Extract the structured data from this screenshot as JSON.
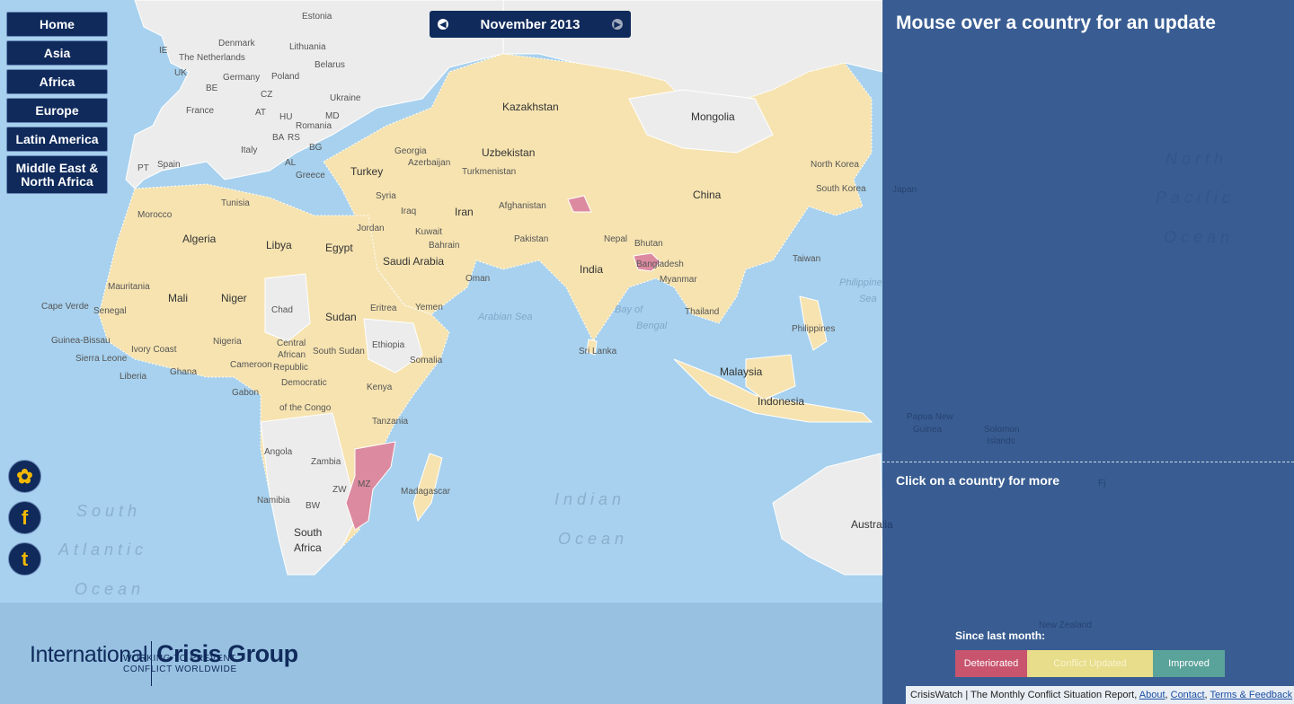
{
  "nav": [
    "Home",
    "Asia",
    "Africa",
    "Europe",
    "Latin America",
    "Middle East & North Africa"
  ],
  "month": {
    "label": "November 2013",
    "prev_icon": "chevron-left-icon",
    "next_icon": "chevron-right-icon"
  },
  "panel": {
    "title": "Mouse over a country for an update",
    "more": "Click on a country for more"
  },
  "legend": {
    "title": "Since last month:",
    "items": [
      {
        "label": "Deteriorated",
        "color": "#c8546e"
      },
      {
        "label": "Conflict Updated",
        "color": "#e8dd8a"
      },
      {
        "label": "Improved",
        "color": "#5aa39a"
      }
    ]
  },
  "logo": {
    "word1": "International",
    "word2": "Crisis Group",
    "tagline1": "WORKING TO PREVENT",
    "tagline2": "CONFLICT WORLDWIDE"
  },
  "social": [
    "twitter-icon",
    "facebook-icon",
    "tumblr-icon"
  ],
  "credit": {
    "text": "CrisisWatch | The Monthly Conflict Situation Report, ",
    "links": [
      "About",
      "Contact",
      "Terms & Feedback"
    ]
  },
  "map": {
    "colors": {
      "ocean": "#a7d1ee",
      "land": "#ececec",
      "updated": "#f6e3b0",
      "deteriorated": "#dc8aa0"
    },
    "oceans": [
      "South",
      "Atlantic",
      "Ocean",
      "Indian",
      "Ocean",
      "North",
      "Pacific",
      "Ocean"
    ],
    "seas": [
      "Arabian Sea",
      "Bay of",
      "Bengal",
      "Philippine",
      "Sea"
    ],
    "labels": [
      "Estonia",
      "Denmark",
      "Lithuania",
      "IE",
      "UK",
      "The Netherlands",
      "Belarus",
      "Poland",
      "Germany",
      "BE",
      "CZ",
      "Ukraine",
      "France",
      "AT",
      "HU",
      "MD",
      "Romania",
      "BA",
      "RS",
      "BG",
      "Italy",
      "Spain",
      "PT",
      "AL",
      "Greece",
      "Georgia",
      "Azerbaijan",
      "Kazakhstan",
      "Uzbekistan",
      "Turkmenistan",
      "Mongolia",
      "Turkey",
      "Tunisia",
      "Morocco",
      "Syria",
      "Iraq",
      "Iran",
      "Afghanistan",
      "China",
      "North Korea",
      "South Korea",
      "Japan",
      "Jordan",
      "Kuwait",
      "Bahrain",
      "Pakistan",
      "Nepal",
      "Bhutan",
      "Algeria",
      "Libya",
      "Egypt",
      "Saudi Arabia",
      "India",
      "Bangladesh",
      "Taiwan",
      "Oman",
      "Myanmar",
      "Mauritania",
      "Mali",
      "Niger",
      "Chad",
      "Sudan",
      "Eritrea",
      "Yemen",
      "Thailand",
      "Philippines",
      "Cape Verde",
      "Senegal",
      "Guinea-Bissau",
      "Ivory Coast",
      "Nigeria",
      "Central",
      "African",
      "Republic",
      "South Sudan",
      "Ethiopia",
      "Somalia",
      "Sri Lanka",
      "Sierra Leone",
      "Liberia",
      "Ghana",
      "Cameroon",
      "Malaysia",
      "Gabon",
      "Democratic",
      "of the Congo",
      "Kenya",
      "Indonesia",
      "Tanzania",
      "Papua New",
      "Guinea",
      "Solomon",
      "Islands",
      "Angola",
      "Zambia",
      "MZ",
      "ZW",
      "Madagascar",
      "Namibia",
      "BW",
      "South",
      "Africa",
      "Australia",
      "New Zealand",
      "Fj"
    ]
  }
}
